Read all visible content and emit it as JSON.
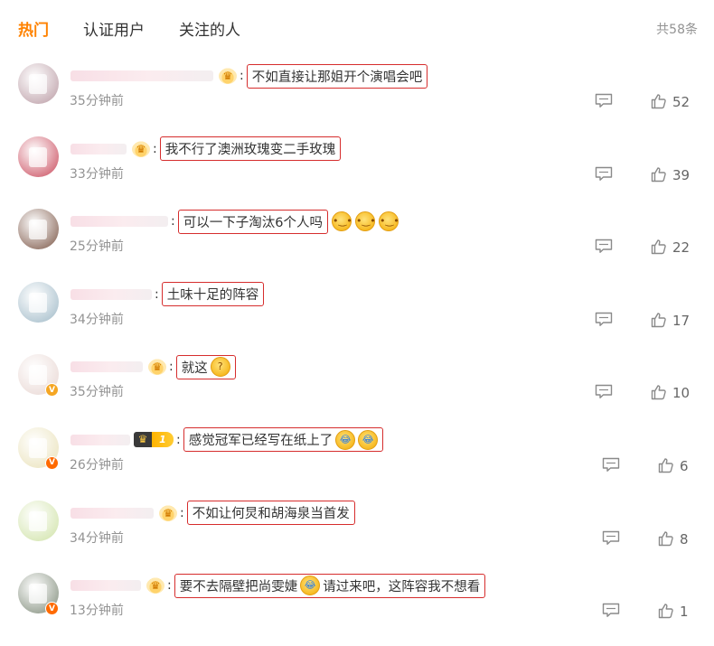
{
  "tabs": [
    {
      "label": "热门",
      "active": true
    },
    {
      "label": "认证用户",
      "active": false
    },
    {
      "label": "关注的人",
      "active": false
    }
  ],
  "total": "共58条",
  "colors": {
    "accent": "#ff8200",
    "highlight_border": "#d62d2d",
    "muted": "#939393"
  },
  "comments": [
    {
      "name_width": 158,
      "badge": "crown",
      "text": "不如直接让那姐开个演唱会吧",
      "emoji": [],
      "time": "35分钟前",
      "likes": "52",
      "avatar_color": "#b99aa3",
      "verified": null
    },
    {
      "name_width": 62,
      "badge": "crown",
      "text": "我不行了澳洲玫瑰变二手玫瑰",
      "emoji": [],
      "time": "33分钟前",
      "likes": "39",
      "avatar_color": "#c9485a",
      "verified": null
    },
    {
      "name_width": 108,
      "badge": "none",
      "text": "可以一下子淘汰6个人吗",
      "emoji": [
        "smile",
        "smile",
        "smile"
      ],
      "time": "25分钟前",
      "likes": "22",
      "avatar_color": "#7a5444",
      "verified": null
    },
    {
      "name_width": 90,
      "badge": "none",
      "text": "土味十足的阵容",
      "emoji": [],
      "time": "34分钟前",
      "likes": "17",
      "avatar_color": "#9fb9c7",
      "verified": null
    },
    {
      "name_width": 80,
      "badge": "crown",
      "text": "就这",
      "emoji": [
        "question"
      ],
      "time": "35分钟前",
      "likes": "10",
      "avatar_color": "#e8d6d2",
      "verified": "gold"
    },
    {
      "name_width": 66,
      "badge": "vip",
      "vip_level": "1",
      "text": "感觉冠军已经写在纸上了",
      "emoji": [
        "cry",
        "cry"
      ],
      "time": "26分钟前",
      "likes": "6",
      "avatar_color": "#e9e1b8",
      "verified": "orange"
    },
    {
      "name_width": 92,
      "badge": "crown",
      "text": "不如让何炅和胡海泉当首发",
      "emoji": [],
      "time": "34分钟前",
      "likes": "8",
      "avatar_color": "#cfe2a6",
      "verified": null
    },
    {
      "name_width": 78,
      "badge": "crown",
      "text": "要不去隔壁把尚雯婕",
      "text2": "请过来吧，这阵容我不想看",
      "emoji_mid": "cry",
      "time": "13分钟前",
      "likes": "1",
      "avatar_color": "#7e8a78",
      "verified": "orange"
    }
  ],
  "icons": {
    "comment": "comment-bubble-icon",
    "like": "thumb-up-icon",
    "crown": "crown-icon",
    "verified": "verified-v-icon"
  }
}
